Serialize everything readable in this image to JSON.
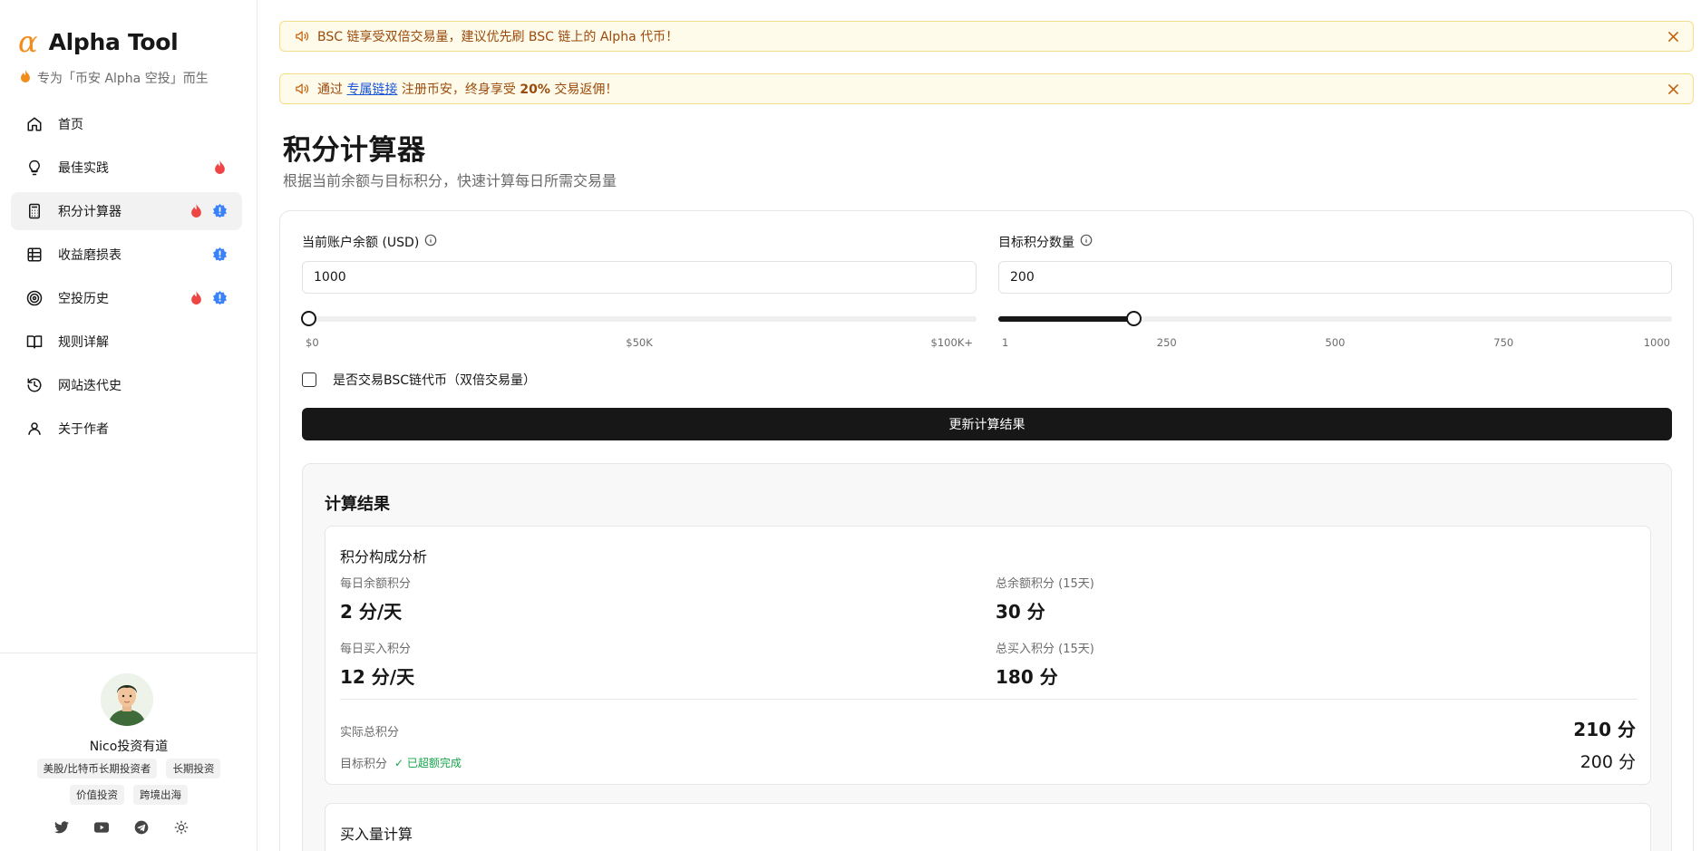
{
  "brand": {
    "logo": "α",
    "title": "Alpha Tool",
    "subtitle": "专为「币安 Alpha 空投」而生"
  },
  "nav": {
    "items": [
      {
        "label": "首页",
        "icon": "home-icon",
        "hot": false,
        "new": false
      },
      {
        "label": "最佳实践",
        "icon": "lightbulb-icon",
        "hot": true,
        "new": false
      },
      {
        "label": "积分计算器",
        "icon": "calculator-icon",
        "hot": true,
        "new": true,
        "active": true
      },
      {
        "label": "收益磨损表",
        "icon": "table-icon",
        "hot": false,
        "new": true
      },
      {
        "label": "空投历史",
        "icon": "target-icon",
        "hot": true,
        "new": true
      },
      {
        "label": "规则详解",
        "icon": "book-icon",
        "hot": false,
        "new": false
      },
      {
        "label": "网站迭代史",
        "icon": "history-icon",
        "hot": false,
        "new": false
      },
      {
        "label": "关于作者",
        "icon": "user-icon",
        "hot": false,
        "new": false
      }
    ]
  },
  "author": {
    "name": "Nico投资有道",
    "tags": [
      "美股/比特币长期投资者",
      "长期投资",
      "价值投资",
      "跨境出海"
    ],
    "socials": [
      "twitter-icon",
      "youtube-icon",
      "telegram-icon",
      "theme-toggle-icon"
    ]
  },
  "notices": [
    {
      "text": "BSC 链享受双倍交易量，建议优先刷 BSC 链上的 Alpha 代币！"
    },
    {
      "prefix": "通过 ",
      "link": "专属链接",
      "middle": " 注册币安，终身享受 ",
      "bold": "20%",
      "suffix": " 交易返佣！"
    }
  ],
  "page": {
    "title": "积分计算器",
    "description": "根据当前余额与目标积分，快速计算每日所需交易量"
  },
  "form": {
    "balance": {
      "label": "当前账户余额 (USD)",
      "value": "1000",
      "slider_fraction": 0.01,
      "ticks": [
        "$0",
        "$50K",
        "$100K+"
      ]
    },
    "target": {
      "label": "目标积分数量",
      "value": "200",
      "slider_fraction": 0.2,
      "ticks": [
        "1",
        "250",
        "500",
        "750",
        "1000"
      ]
    },
    "bsc_checkbox_label": "是否交易BSC链代币（双倍交易量）",
    "bsc_checked": false,
    "update_button": "更新计算结果"
  },
  "results": {
    "title": "计算结果",
    "analysis": {
      "title": "积分构成分析",
      "daily_balance_label": "每日余额积分",
      "daily_balance_value": "2 分/天",
      "total_balance_label": "总余额积分 (15天)",
      "total_balance_value": "30 分",
      "daily_buy_label": "每日买入积分",
      "daily_buy_value": "12 分/天",
      "total_buy_label": "总买入积分 (15天)",
      "total_buy_value": "180 分",
      "actual_total_label": "实际总积分",
      "actual_total_value": "210 分",
      "target_label": "目标积分",
      "target_status": "✓ 已超额完成",
      "target_value": "200 分"
    },
    "buy_calc_title": "买入量计算"
  },
  "colors": {
    "accent": "#f28c1a",
    "hot": "#ef4444",
    "new": "#3b82f6",
    "success": "#16a34a",
    "notice_bg": "#fffbea",
    "notice_text": "#9a4a0c"
  }
}
